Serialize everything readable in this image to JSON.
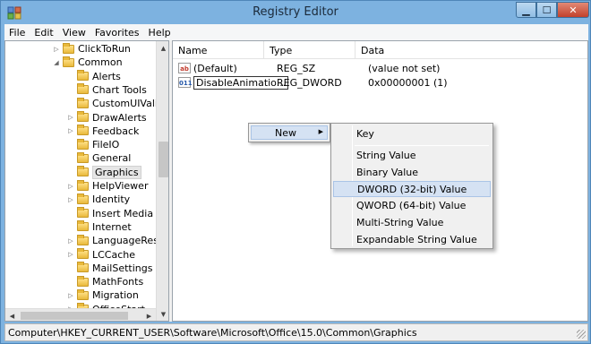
{
  "window": {
    "title": "Registry Editor",
    "icons": {
      "app": "registry-icon",
      "minimize": "minimize-icon",
      "maximize": "maximize-icon",
      "close": "close-icon"
    }
  },
  "menu": [
    "File",
    "Edit",
    "View",
    "Favorites",
    "Help"
  ],
  "tree": [
    {
      "label": "ClickToRun",
      "expander": "▷"
    },
    {
      "label": "Common",
      "expander": "◢"
    },
    {
      "label": "Alerts",
      "expander": ""
    },
    {
      "label": "Chart Tools",
      "expander": ""
    },
    {
      "label": "CustomUIValida",
      "expander": ""
    },
    {
      "label": "DrawAlerts",
      "expander": "▷"
    },
    {
      "label": "Feedback",
      "expander": "▷"
    },
    {
      "label": "FileIO",
      "expander": ""
    },
    {
      "label": "General",
      "expander": ""
    },
    {
      "label": "Graphics",
      "expander": "",
      "selected": true
    },
    {
      "label": "HelpViewer",
      "expander": "▷"
    },
    {
      "label": "Identity",
      "expander": "▷"
    },
    {
      "label": "Insert Media",
      "expander": ""
    },
    {
      "label": "Internet",
      "expander": ""
    },
    {
      "label": "LanguageResou",
      "expander": "▷"
    },
    {
      "label": "LCCache",
      "expander": "▷"
    },
    {
      "label": "MailSettings",
      "expander": ""
    },
    {
      "label": "MathFonts",
      "expander": ""
    },
    {
      "label": "Migration",
      "expander": "▷"
    },
    {
      "label": "OfficeStart",
      "expander": "▷"
    }
  ],
  "list": {
    "headers": {
      "name": "Name",
      "type": "Type",
      "data": "Data"
    },
    "rows": [
      {
        "icon": "ab",
        "name": "(Default)",
        "type": "REG_SZ",
        "data": "(value not set)"
      },
      {
        "icon": "011",
        "name": "DisableAnimatio...",
        "type": "REG_DWORD",
        "data": "0x00000001 (1)"
      }
    ]
  },
  "context_menu": {
    "new_label": "New",
    "submenu": {
      "key": "Key",
      "string": "String Value",
      "binary": "Binary Value",
      "dword": "DWORD (32-bit) Value",
      "qword": "QWORD (64-bit) Value",
      "multi": "Multi-String Value",
      "expandable": "Expandable String Value"
    }
  },
  "status": {
    "path": "Computer\\HKEY_CURRENT_USER\\Software\\Microsoft\\Office\\15.0\\Common\\Graphics"
  }
}
